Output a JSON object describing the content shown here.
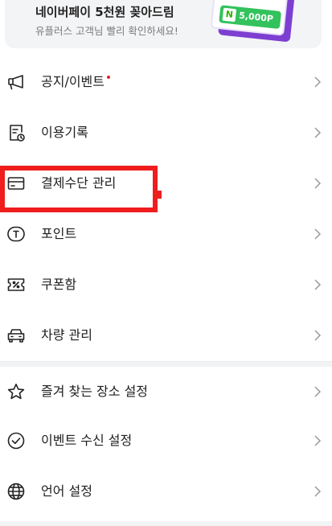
{
  "banner": {
    "title": "네이버페이 5천원 꽂아드림",
    "subtitle": "유플러스 고객님 빨리 확인하세요!",
    "voucher_amount": "5,000P",
    "voucher_brand": "N"
  },
  "menu": {
    "items": [
      {
        "label": "공지/이벤트",
        "icon": "megaphone-icon",
        "has_badge": true
      },
      {
        "label": "이용기록",
        "icon": "history-receipt-icon"
      },
      {
        "label": "결제수단 관리",
        "icon": "card-icon",
        "highlighted": true
      },
      {
        "label": "포인트",
        "icon": "point-coin-icon"
      },
      {
        "label": "쿠폰함",
        "icon": "coupon-icon"
      },
      {
        "label": "차량 관리",
        "icon": "car-icon"
      }
    ],
    "settings": [
      {
        "label": "즐겨 찾는 장소 설정",
        "icon": "star-icon"
      },
      {
        "label": "이벤트 수신 설정",
        "icon": "check-circle-icon"
      },
      {
        "label": "언어 설정",
        "icon": "globe-icon"
      }
    ]
  },
  "colors": {
    "badge": "#e0242d",
    "highlight": "#ef1d1d",
    "voucher_purple": "#7d3fd1",
    "voucher_green": "#33c25c"
  }
}
